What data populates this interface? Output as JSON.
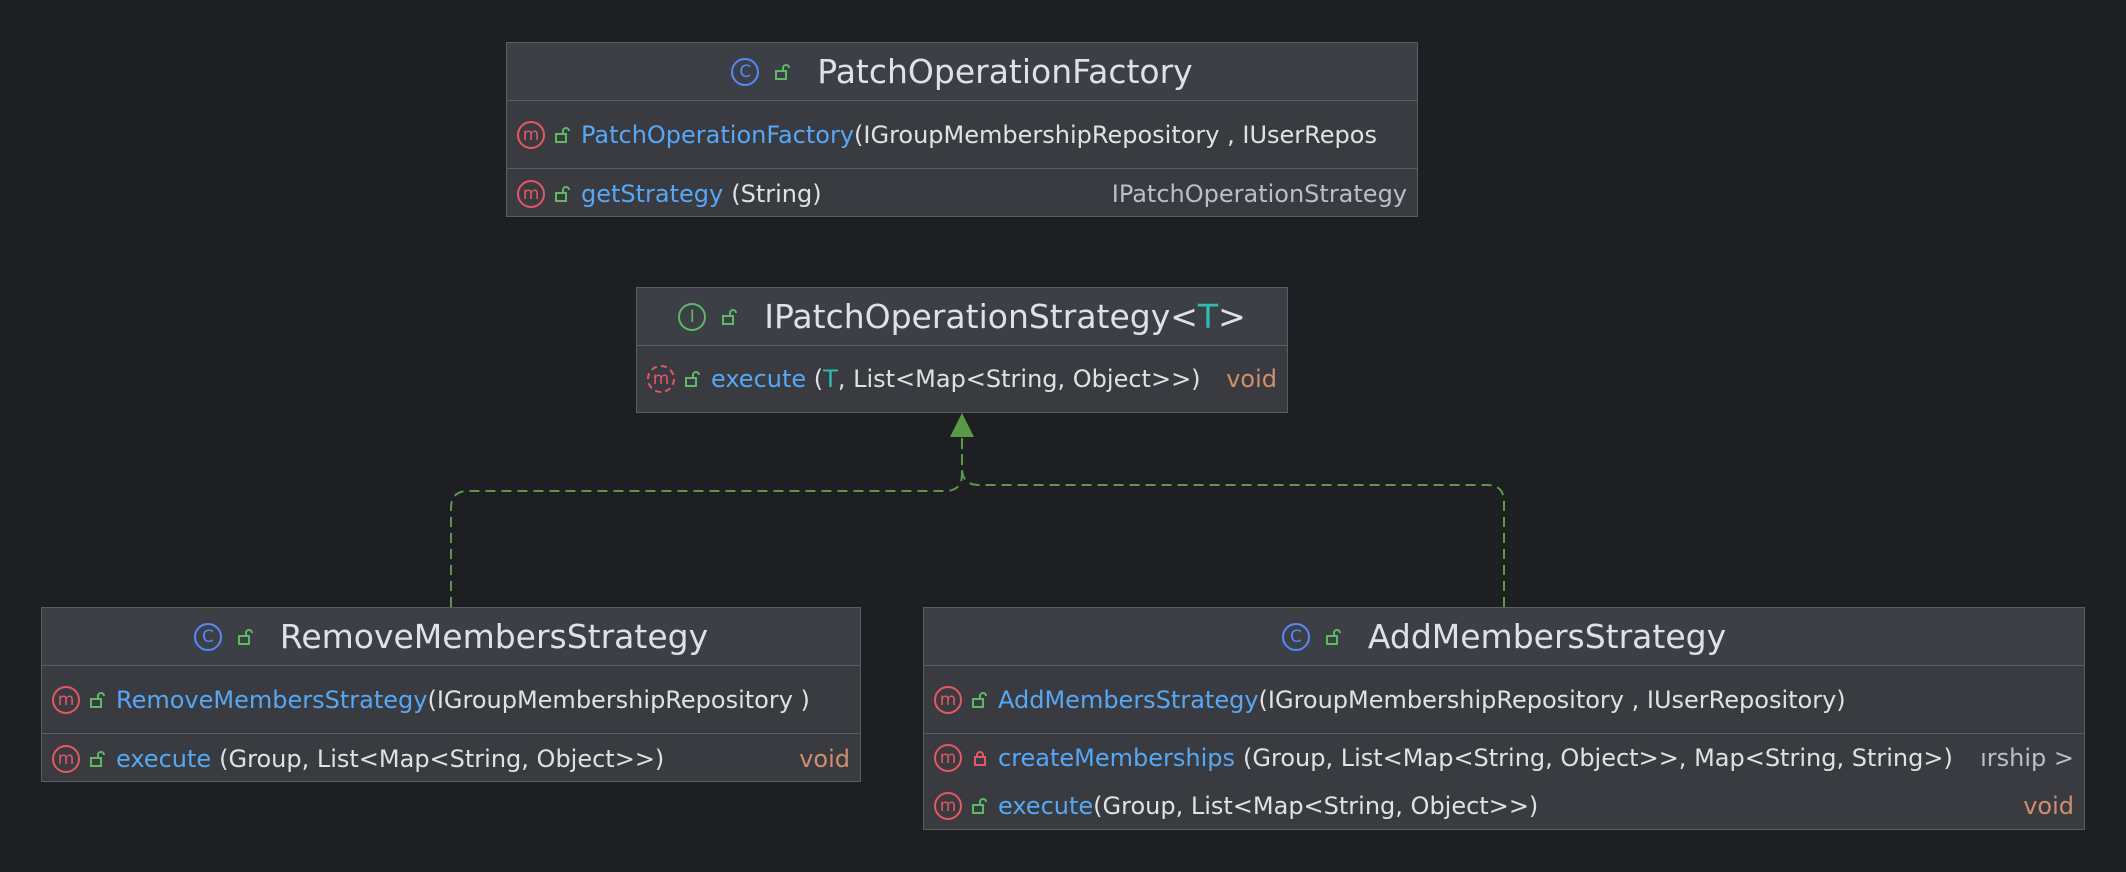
{
  "classes": {
    "factory": {
      "name": "PatchOperationFactory",
      "methods": [
        {
          "name": "PatchOperationFactory",
          "params": "(IGroupMembershipRepository , IUserRepos",
          "ret": ""
        },
        {
          "name": "getStrategy",
          "params": "(String)",
          "ret": "IPatchOperationStrategy"
        }
      ]
    },
    "iface": {
      "name": "IPatchOperationStrategy<",
      "type_param": "T",
      "name_close": ">",
      "method": {
        "name": "execute",
        "open": " (",
        "tparam": "T",
        "rest": ", List<Map<String, Object>>)",
        "ret": "void"
      }
    },
    "remove": {
      "name": "RemoveMembersStrategy",
      "methods": [
        {
          "name": "RemoveMembersStrategy",
          "params": "(IGroupMembershipRepository )",
          "ret": ""
        },
        {
          "name": "execute",
          "params": "(Group, List<Map<String, Object>>)",
          "ret": "void"
        }
      ]
    },
    "add": {
      "name": "AddMembersStrategy",
      "methods": [
        {
          "name": "AddMembersStrategy",
          "params": "(IGroupMembershipRepository , IUserRepository)",
          "ret": ""
        },
        {
          "name": "createMemberships",
          "params": "(Group, List<Map<String, Object>>, Map<String, String>)",
          "ret": "ırship >"
        },
        {
          "name": "execute",
          "params": "(Group, List<Map<String, Object>>)",
          "ret": "void"
        }
      ]
    }
  },
  "icons": {
    "class_letter": "C",
    "interface_letter": "I",
    "method_letter": "m"
  },
  "colors": {
    "background": "#1e1f22",
    "method_name": "#56a8f5",
    "return_void": "#cf8e6d",
    "type_param": "#2fbcb2",
    "edge": "#5a9a46"
  }
}
